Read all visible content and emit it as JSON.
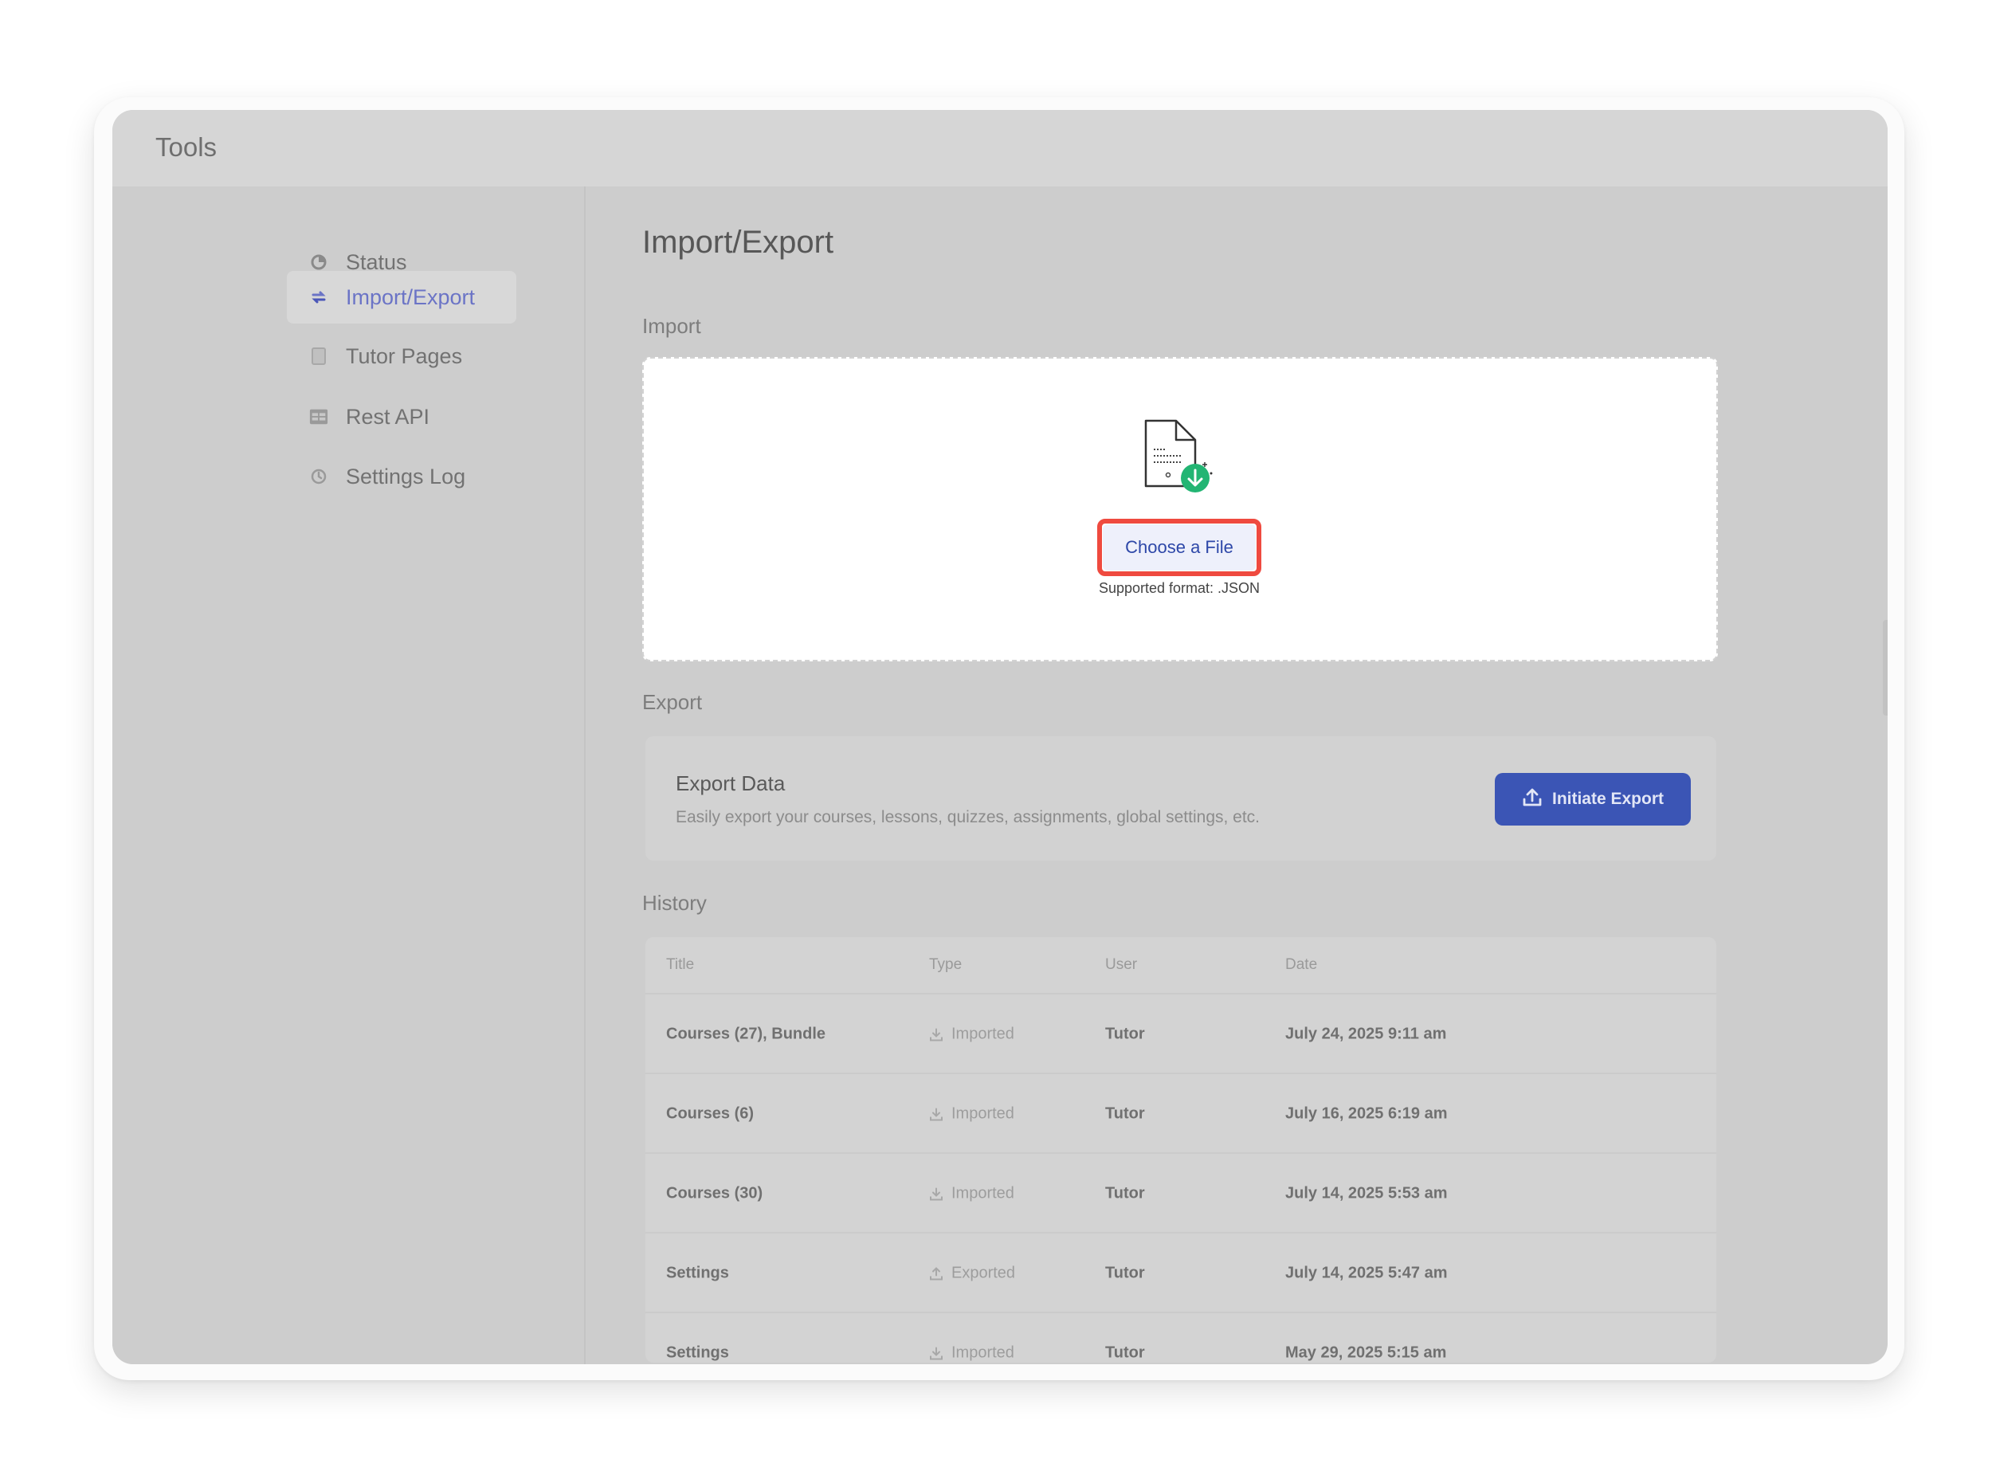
{
  "app": {
    "title": "Tools"
  },
  "sidebar": {
    "items": [
      {
        "label": "Status",
        "icon": "status-icon",
        "active": false
      },
      {
        "label": "Import/Export",
        "icon": "import-export-icon",
        "active": true
      },
      {
        "label": "Tutor Pages",
        "icon": "pages-icon",
        "active": false
      },
      {
        "label": "Rest API",
        "icon": "api-icon",
        "active": false
      },
      {
        "label": "Settings Log",
        "icon": "history-icon",
        "active": false
      }
    ]
  },
  "main": {
    "title": "Import/Export",
    "import": {
      "section_label": "Import",
      "choose_button": "Choose a File",
      "supported_format": "Supported format: .JSON"
    },
    "export": {
      "section_label": "Export",
      "card_title": "Export Data",
      "card_description": "Easily export your courses, lessons, quizzes, assignments, global settings, etc.",
      "button_label": "Initiate Export"
    },
    "history": {
      "section_label": "History",
      "columns": [
        "Title",
        "Type",
        "User",
        "Date"
      ],
      "rows": [
        {
          "title": "Courses (27), Bundle",
          "type": "Imported",
          "user": "Tutor",
          "date": "July 24, 2025 9:11 am"
        },
        {
          "title": "Courses (6)",
          "type": "Imported",
          "user": "Tutor",
          "date": "July 16, 2025 6:19 am"
        },
        {
          "title": "Courses (30)",
          "type": "Imported",
          "user": "Tutor",
          "date": "July 14, 2025 5:53 am"
        },
        {
          "title": "Settings",
          "type": "Exported",
          "user": "Tutor",
          "date": "July 14, 2025 5:47 am"
        },
        {
          "title": "Settings",
          "type": "Imported",
          "user": "Tutor",
          "date": "May 29, 2025 5:15 am"
        }
      ]
    }
  },
  "colors": {
    "accent": "#3b55b5",
    "highlight": "#ef4a3f",
    "success": "#22b573",
    "active_nav": "#6b74c6"
  }
}
